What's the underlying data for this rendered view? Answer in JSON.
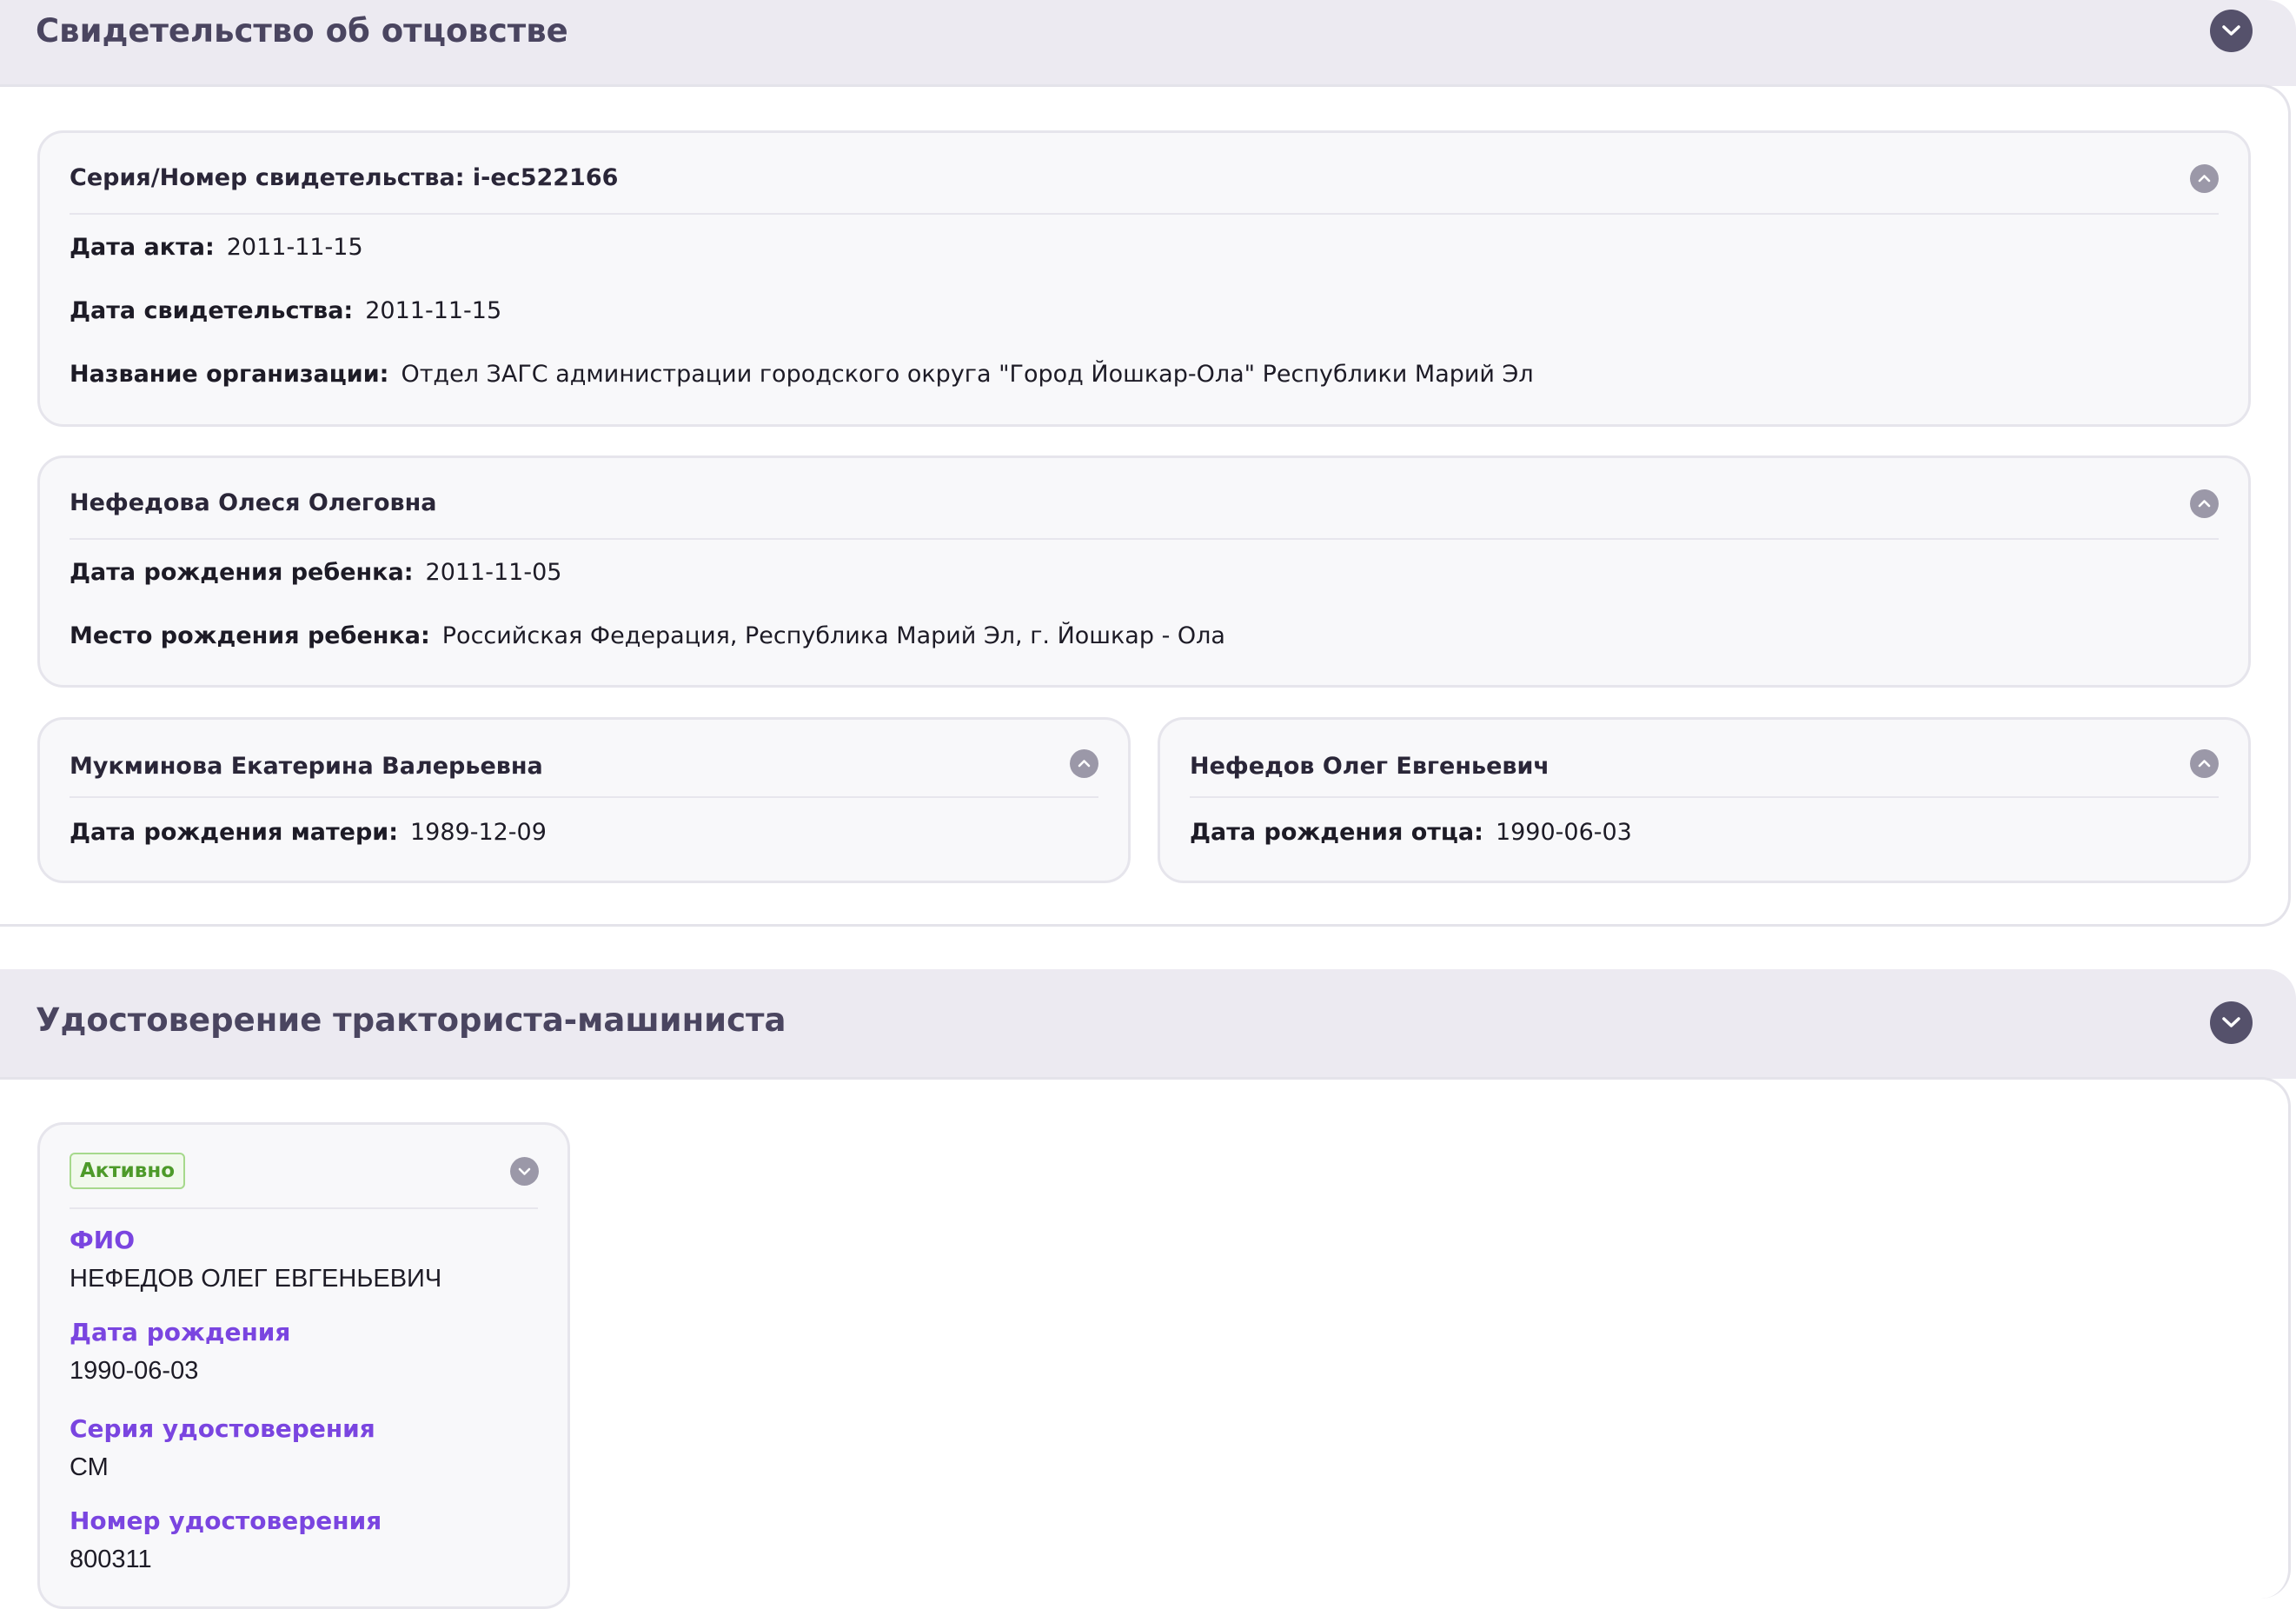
{
  "paternity": {
    "title": "Свидетельство об отцовстве",
    "certificate": {
      "title": "Серия/Номер свидетельства: i-ec522166",
      "fields": [
        {
          "label": "Дата акта:",
          "value": "2011-11-15"
        },
        {
          "label": "Дата свидетельства:",
          "value": "2011-11-15"
        },
        {
          "label": "Название организации:",
          "value": "Отдел ЗАГС администрации городского округа \"Город Йошкар-Ола\" Республики Марий Эл"
        }
      ]
    },
    "child": {
      "title": "Нефедова Олеся Олеговна",
      "fields": [
        {
          "label": "Дата рождения ребенка:",
          "value": "2011-11-05"
        },
        {
          "label": "Место рождения ребенка:",
          "value": "Российская Федерация, Республика Марий Эл, г. Йошкар - Ола"
        }
      ]
    },
    "mother": {
      "title": "Мукминова Екатерина Валерьевна",
      "fields": [
        {
          "label": "Дата рождения матери:",
          "value": "1989-12-09"
        }
      ]
    },
    "father": {
      "title": "Нефедов Олег Евгеньевич",
      "fields": [
        {
          "label": "Дата рождения отца:",
          "value": "1990-06-03"
        }
      ]
    }
  },
  "tractor": {
    "title": "Удостоверение тракториста-машиниста",
    "card": {
      "status": "Активно",
      "fields": [
        {
          "label": "ФИО",
          "value": "НЕФЕДОВ ОЛЕГ ЕВГЕНЬЕВИЧ"
        },
        {
          "label": "Дата рождения",
          "value": "1990-06-03"
        },
        {
          "label": "Серия удостоверения",
          "value": "СМ"
        },
        {
          "label": "Номер удостоверения",
          "value": "800311"
        }
      ]
    }
  },
  "icons": {
    "section_toggle": "chevron-down-icon",
    "card_collapse": "chevron-up-icon",
    "card_expand": "chevron-down-icon"
  },
  "colors": {
    "header_bg": "#eceaf1",
    "toggle_dark": "#55516b",
    "label_accent": "#7a45e0",
    "status_green": "#4d9a2a"
  }
}
